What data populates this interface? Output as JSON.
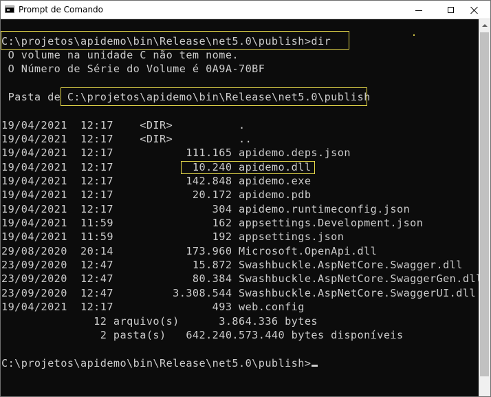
{
  "window": {
    "title": "Prompt de Comando",
    "icon": "cmd-icon",
    "buttons": {
      "minimize": "minimize-icon",
      "maximize": "maximize-icon",
      "close": "close-icon"
    }
  },
  "colors": {
    "console_bg": "#0c0c0c",
    "console_text": "#cccccc",
    "highlight": "#e5d84a"
  },
  "console": {
    "lines": [
      "C:\\projetos\\apidemo\\bin\\Release\\net5.0\\publish>dir",
      " O volume na unidade C não tem nome.",
      " O Número de Série do Volume é 0A9A-70BF",
      "",
      " Pasta de C:\\projetos\\apidemo\\bin\\Release\\net5.0\\publish",
      "",
      "19/04/2021  12:17    <DIR>          .",
      "19/04/2021  12:17    <DIR>          ..",
      "19/04/2021  12:17           111.165 apidemo.deps.json",
      "19/04/2021  12:17            10.240 apidemo.dll",
      "19/04/2021  12:17           142.848 apidemo.exe",
      "19/04/2021  12:17            20.172 apidemo.pdb",
      "19/04/2021  12:17               304 apidemo.runtimeconfig.json",
      "19/04/2021  11:59               162 appsettings.Development.json",
      "19/04/2021  11:59               192 appsettings.json",
      "29/08/2020  20:14           173.960 Microsoft.OpenApi.dll",
      "23/09/2020  12:47            15.872 Swashbuckle.AspNetCore.Swagger.dll",
      "23/09/2020  12:47            80.384 Swashbuckle.AspNetCore.SwaggerGen.dll",
      "23/09/2020  12:47         3.308.544 Swashbuckle.AspNetCore.SwaggerUI.dll",
      "19/04/2021  12:17               493 web.config",
      "              12 arquivo(s)      3.864.336 bytes",
      "               2 pasta(s)   642.240.573.440 bytes disponíveis",
      "",
      "C:\\projetos\\apidemo\\bin\\Release\\net5.0\\publish>"
    ]
  }
}
